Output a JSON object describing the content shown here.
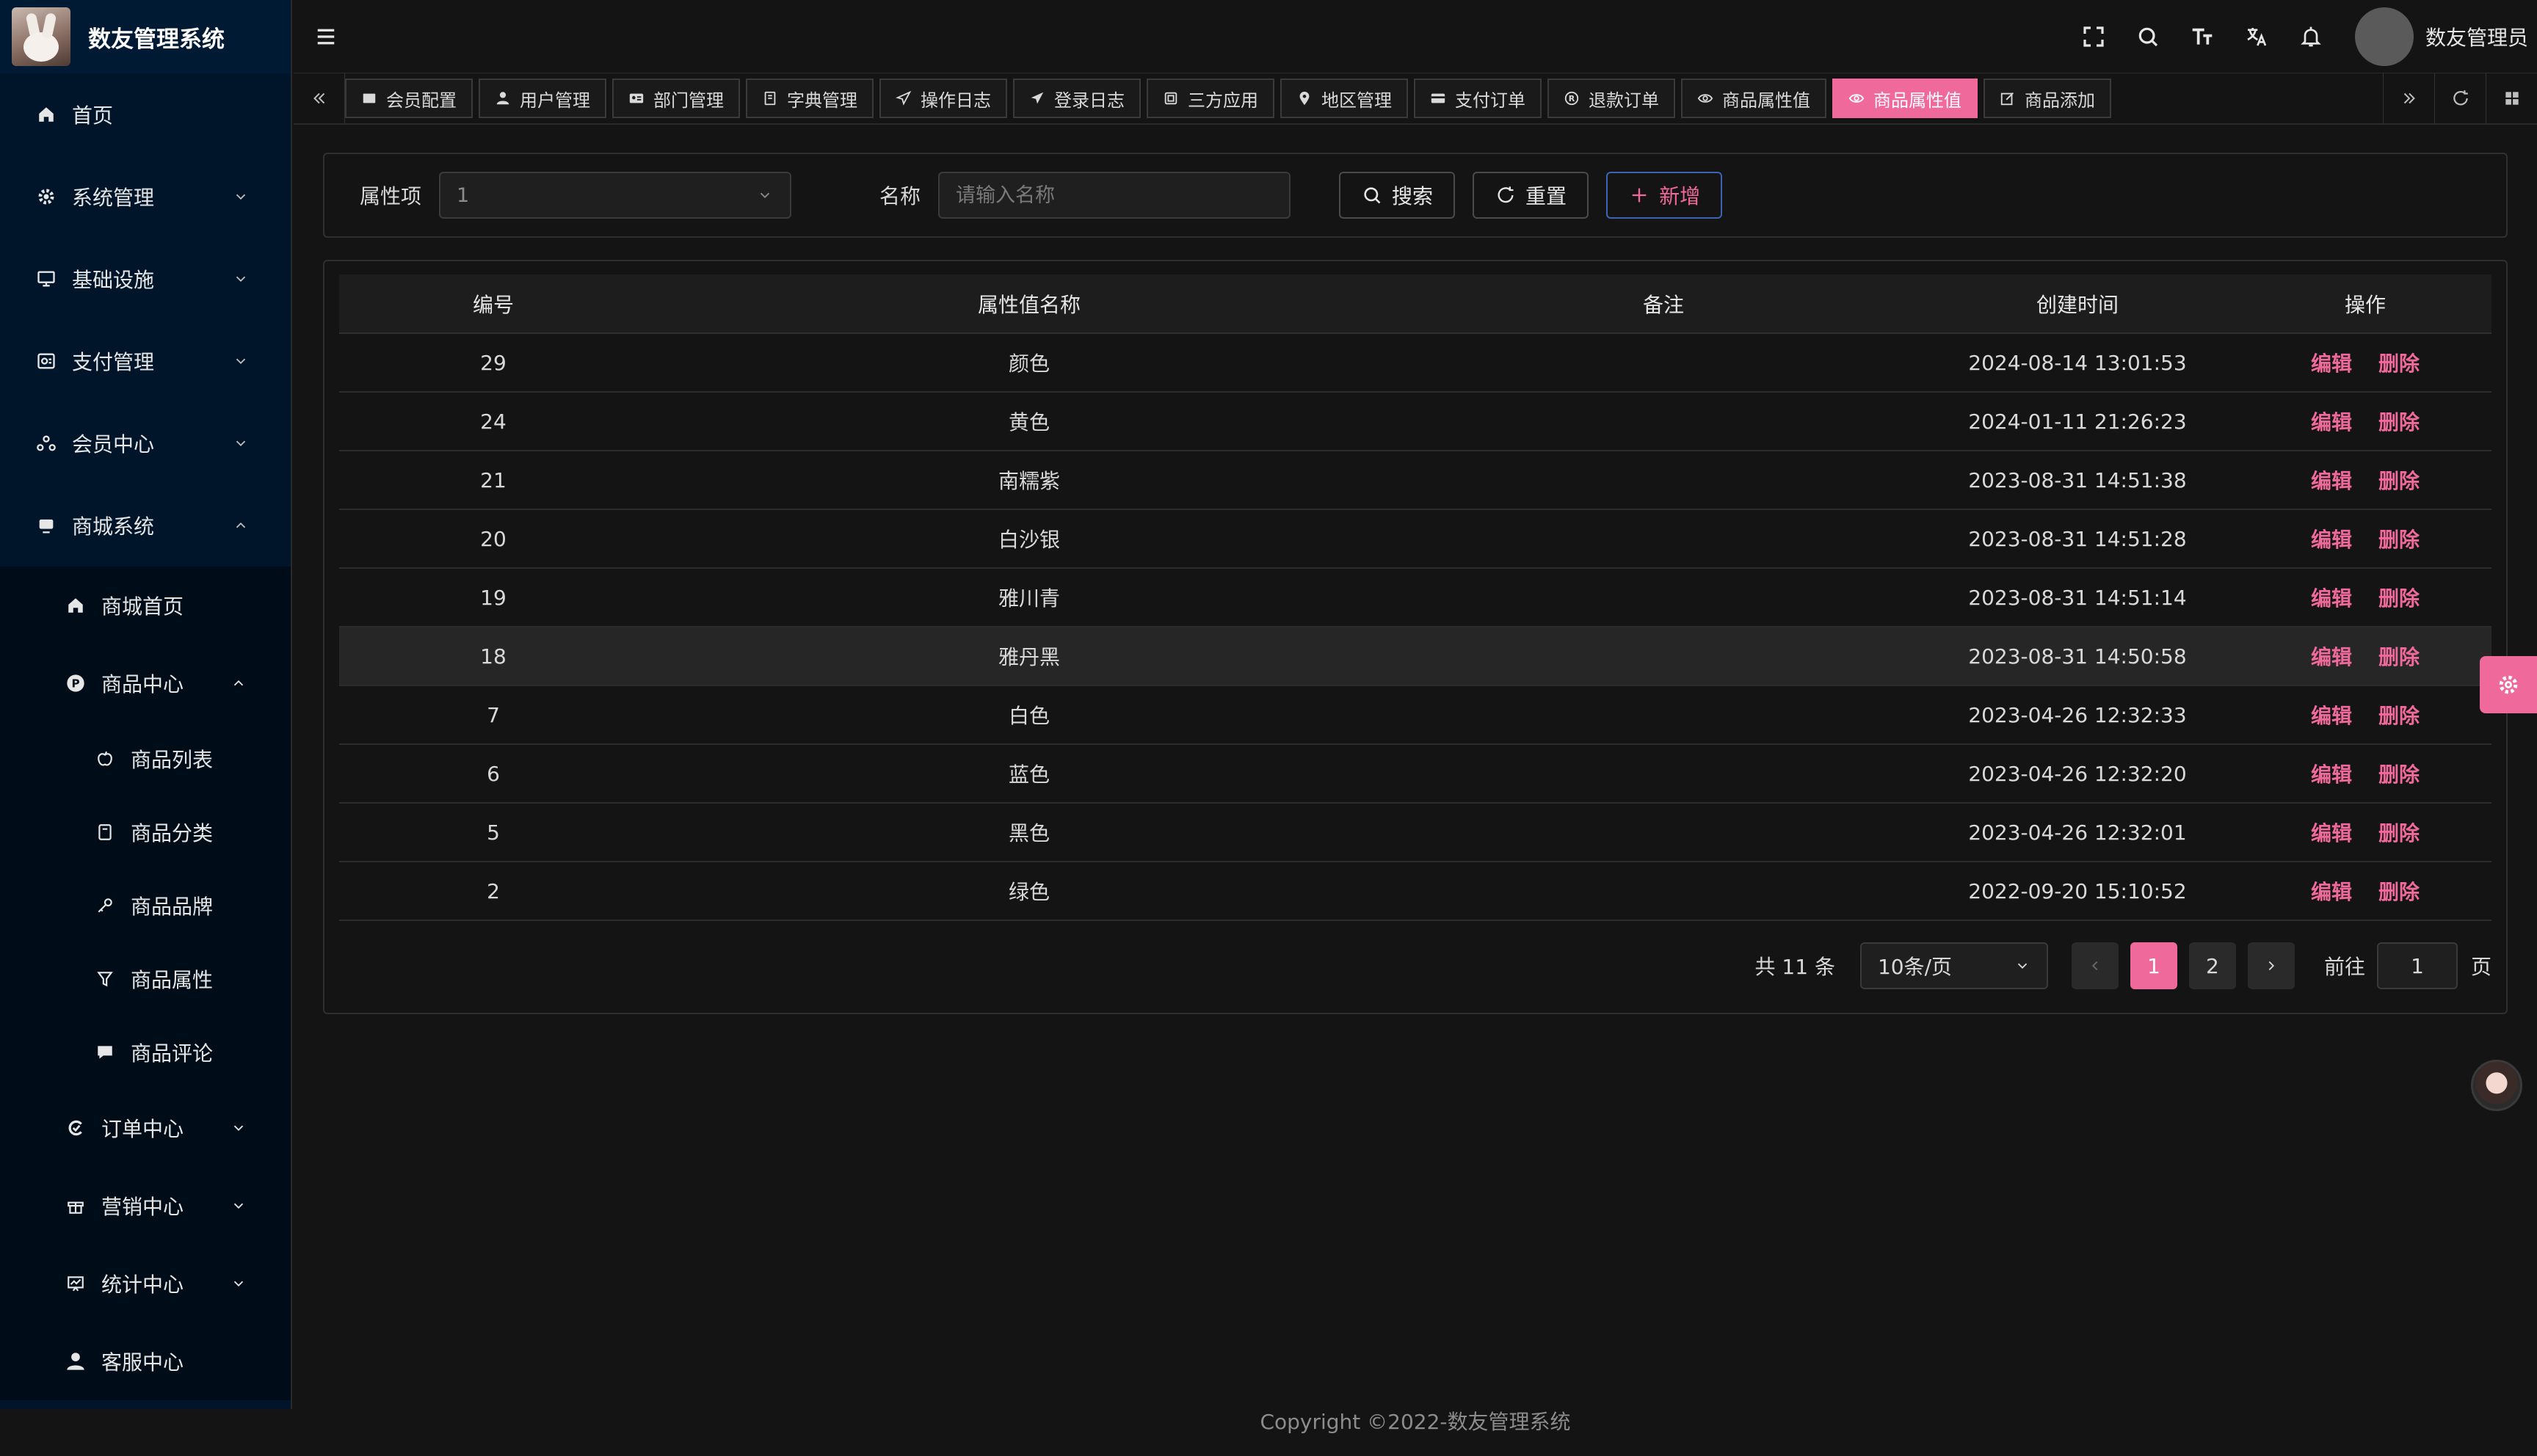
{
  "app": {
    "title": "数友管理系统"
  },
  "header": {
    "user_name": "数友管理员"
  },
  "sidebar": {
    "items": [
      {
        "label": "首页",
        "icon": "home-icon"
      },
      {
        "label": "系统管理",
        "icon": "gear-icon"
      },
      {
        "label": "基础设施",
        "icon": "monitor-icon"
      },
      {
        "label": "支付管理",
        "icon": "payment-icon"
      },
      {
        "label": "会员中心",
        "icon": "members-icon"
      },
      {
        "label": "商城系统",
        "icon": "shop-icon"
      }
    ],
    "shop_sub": [
      {
        "label": "商城首页",
        "icon": "home-icon"
      },
      {
        "label": "商品中心",
        "icon": "product-center-icon"
      }
    ],
    "product_sub": [
      {
        "label": "商品列表",
        "icon": "apple-icon"
      },
      {
        "label": "商品分类",
        "icon": "category-icon"
      },
      {
        "label": "商品品牌",
        "icon": "brand-icon"
      },
      {
        "label": "商品属性",
        "icon": "attribute-icon"
      },
      {
        "label": "商品评论",
        "icon": "comment-icon"
      }
    ],
    "shop_sub_after": [
      {
        "label": "订单中心",
        "icon": "order-icon"
      },
      {
        "label": "营销中心",
        "icon": "gift-icon"
      },
      {
        "label": "统计中心",
        "icon": "stats-icon"
      },
      {
        "label": "客服中心",
        "icon": "user-icon"
      }
    ]
  },
  "tabs": [
    {
      "label": "会员配置",
      "icon": "card-icon",
      "active": false
    },
    {
      "label": "用户管理",
      "icon": "user-icon",
      "active": false
    },
    {
      "label": "部门管理",
      "icon": "id-card-icon",
      "active": false
    },
    {
      "label": "字典管理",
      "icon": "book-icon",
      "active": false
    },
    {
      "label": "操作日志",
      "icon": "send-icon",
      "active": false
    },
    {
      "label": "登录日志",
      "icon": "send-filled-icon",
      "active": false
    },
    {
      "label": "三方应用",
      "icon": "app-icon",
      "active": false
    },
    {
      "label": "地区管理",
      "icon": "location-icon",
      "active": false
    },
    {
      "label": "支付订单",
      "icon": "credit-card-icon",
      "active": false
    },
    {
      "label": "退款订单",
      "icon": "refund-icon",
      "active": false
    },
    {
      "label": "商品属性值",
      "icon": "eye-icon",
      "active": false
    },
    {
      "label": "商品属性值",
      "icon": "eye-icon",
      "active": true
    },
    {
      "label": "商品添加",
      "icon": "edit-icon",
      "active": false
    }
  ],
  "search": {
    "attr_label": "属性项",
    "attr_value": "1",
    "name_label": "名称",
    "name_placeholder": "请输入名称",
    "search_btn": "搜索",
    "reset_btn": "重置",
    "add_btn": "新增"
  },
  "table": {
    "columns": [
      "编号",
      "属性值名称",
      "备注",
      "创建时间",
      "操作"
    ],
    "edit_label": "编辑",
    "delete_label": "删除",
    "rows": [
      {
        "id": "29",
        "name": "颜色",
        "remark": "",
        "created": "2024-08-14 13:01:53"
      },
      {
        "id": "24",
        "name": "黄色",
        "remark": "",
        "created": "2024-01-11 21:26:23"
      },
      {
        "id": "21",
        "name": "南糯紫",
        "remark": "",
        "created": "2023-08-31 14:51:38"
      },
      {
        "id": "20",
        "name": "白沙银",
        "remark": "",
        "created": "2023-08-31 14:51:28"
      },
      {
        "id": "19",
        "name": "雅川青",
        "remark": "",
        "created": "2023-08-31 14:51:14"
      },
      {
        "id": "18",
        "name": "雅丹黑",
        "remark": "",
        "created": "2023-08-31 14:50:58"
      },
      {
        "id": "7",
        "name": "白色",
        "remark": "",
        "created": "2023-04-26 12:32:33"
      },
      {
        "id": "6",
        "name": "蓝色",
        "remark": "",
        "created": "2023-04-26 12:32:20"
      },
      {
        "id": "5",
        "name": "黑色",
        "remark": "",
        "created": "2023-04-26 12:32:01"
      },
      {
        "id": "2",
        "name": "绿色",
        "remark": "",
        "created": "2022-09-20 15:10:52"
      }
    ]
  },
  "pagination": {
    "total_text": "共 11 条",
    "page_size": "10条/页",
    "pages": [
      "1",
      "2"
    ],
    "current": "1",
    "goto_label": "前往",
    "goto_value": "1",
    "page_suffix": "页"
  },
  "footer": {
    "copyright": "Copyright ©2022-数友管理系统"
  },
  "colors": {
    "accent": "#f0699b",
    "sidebar_bg": "#001529",
    "body_bg": "#141414"
  }
}
